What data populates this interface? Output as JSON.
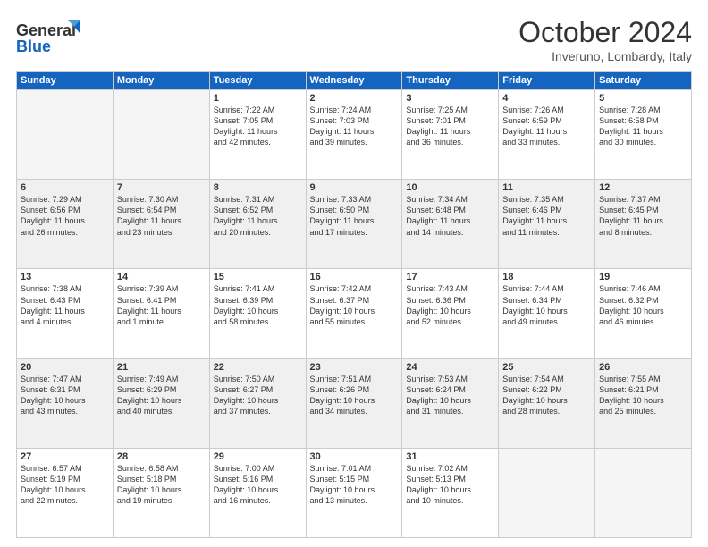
{
  "header": {
    "logo_general": "General",
    "logo_blue": "Blue",
    "month_title": "October 2024",
    "location": "Inveruno, Lombardy, Italy"
  },
  "days_of_week": [
    "Sunday",
    "Monday",
    "Tuesday",
    "Wednesday",
    "Thursday",
    "Friday",
    "Saturday"
  ],
  "weeks": [
    [
      {
        "day": "",
        "info": ""
      },
      {
        "day": "",
        "info": ""
      },
      {
        "day": "1",
        "info": "Sunrise: 7:22 AM\nSunset: 7:05 PM\nDaylight: 11 hours\nand 42 minutes."
      },
      {
        "day": "2",
        "info": "Sunrise: 7:24 AM\nSunset: 7:03 PM\nDaylight: 11 hours\nand 39 minutes."
      },
      {
        "day": "3",
        "info": "Sunrise: 7:25 AM\nSunset: 7:01 PM\nDaylight: 11 hours\nand 36 minutes."
      },
      {
        "day": "4",
        "info": "Sunrise: 7:26 AM\nSunset: 6:59 PM\nDaylight: 11 hours\nand 33 minutes."
      },
      {
        "day": "5",
        "info": "Sunrise: 7:28 AM\nSunset: 6:58 PM\nDaylight: 11 hours\nand 30 minutes."
      }
    ],
    [
      {
        "day": "6",
        "info": "Sunrise: 7:29 AM\nSunset: 6:56 PM\nDaylight: 11 hours\nand 26 minutes."
      },
      {
        "day": "7",
        "info": "Sunrise: 7:30 AM\nSunset: 6:54 PM\nDaylight: 11 hours\nand 23 minutes."
      },
      {
        "day": "8",
        "info": "Sunrise: 7:31 AM\nSunset: 6:52 PM\nDaylight: 11 hours\nand 20 minutes."
      },
      {
        "day": "9",
        "info": "Sunrise: 7:33 AM\nSunset: 6:50 PM\nDaylight: 11 hours\nand 17 minutes."
      },
      {
        "day": "10",
        "info": "Sunrise: 7:34 AM\nSunset: 6:48 PM\nDaylight: 11 hours\nand 14 minutes."
      },
      {
        "day": "11",
        "info": "Sunrise: 7:35 AM\nSunset: 6:46 PM\nDaylight: 11 hours\nand 11 minutes."
      },
      {
        "day": "12",
        "info": "Sunrise: 7:37 AM\nSunset: 6:45 PM\nDaylight: 11 hours\nand 8 minutes."
      }
    ],
    [
      {
        "day": "13",
        "info": "Sunrise: 7:38 AM\nSunset: 6:43 PM\nDaylight: 11 hours\nand 4 minutes."
      },
      {
        "day": "14",
        "info": "Sunrise: 7:39 AM\nSunset: 6:41 PM\nDaylight: 11 hours\nand 1 minute."
      },
      {
        "day": "15",
        "info": "Sunrise: 7:41 AM\nSunset: 6:39 PM\nDaylight: 10 hours\nand 58 minutes."
      },
      {
        "day": "16",
        "info": "Sunrise: 7:42 AM\nSunset: 6:37 PM\nDaylight: 10 hours\nand 55 minutes."
      },
      {
        "day": "17",
        "info": "Sunrise: 7:43 AM\nSunset: 6:36 PM\nDaylight: 10 hours\nand 52 minutes."
      },
      {
        "day": "18",
        "info": "Sunrise: 7:44 AM\nSunset: 6:34 PM\nDaylight: 10 hours\nand 49 minutes."
      },
      {
        "day": "19",
        "info": "Sunrise: 7:46 AM\nSunset: 6:32 PM\nDaylight: 10 hours\nand 46 minutes."
      }
    ],
    [
      {
        "day": "20",
        "info": "Sunrise: 7:47 AM\nSunset: 6:31 PM\nDaylight: 10 hours\nand 43 minutes."
      },
      {
        "day": "21",
        "info": "Sunrise: 7:49 AM\nSunset: 6:29 PM\nDaylight: 10 hours\nand 40 minutes."
      },
      {
        "day": "22",
        "info": "Sunrise: 7:50 AM\nSunset: 6:27 PM\nDaylight: 10 hours\nand 37 minutes."
      },
      {
        "day": "23",
        "info": "Sunrise: 7:51 AM\nSunset: 6:26 PM\nDaylight: 10 hours\nand 34 minutes."
      },
      {
        "day": "24",
        "info": "Sunrise: 7:53 AM\nSunset: 6:24 PM\nDaylight: 10 hours\nand 31 minutes."
      },
      {
        "day": "25",
        "info": "Sunrise: 7:54 AM\nSunset: 6:22 PM\nDaylight: 10 hours\nand 28 minutes."
      },
      {
        "day": "26",
        "info": "Sunrise: 7:55 AM\nSunset: 6:21 PM\nDaylight: 10 hours\nand 25 minutes."
      }
    ],
    [
      {
        "day": "27",
        "info": "Sunrise: 6:57 AM\nSunset: 5:19 PM\nDaylight: 10 hours\nand 22 minutes."
      },
      {
        "day": "28",
        "info": "Sunrise: 6:58 AM\nSunset: 5:18 PM\nDaylight: 10 hours\nand 19 minutes."
      },
      {
        "day": "29",
        "info": "Sunrise: 7:00 AM\nSunset: 5:16 PM\nDaylight: 10 hours\nand 16 minutes."
      },
      {
        "day": "30",
        "info": "Sunrise: 7:01 AM\nSunset: 5:15 PM\nDaylight: 10 hours\nand 13 minutes."
      },
      {
        "day": "31",
        "info": "Sunrise: 7:02 AM\nSunset: 5:13 PM\nDaylight: 10 hours\nand 10 minutes."
      },
      {
        "day": "",
        "info": ""
      },
      {
        "day": "",
        "info": ""
      }
    ]
  ]
}
